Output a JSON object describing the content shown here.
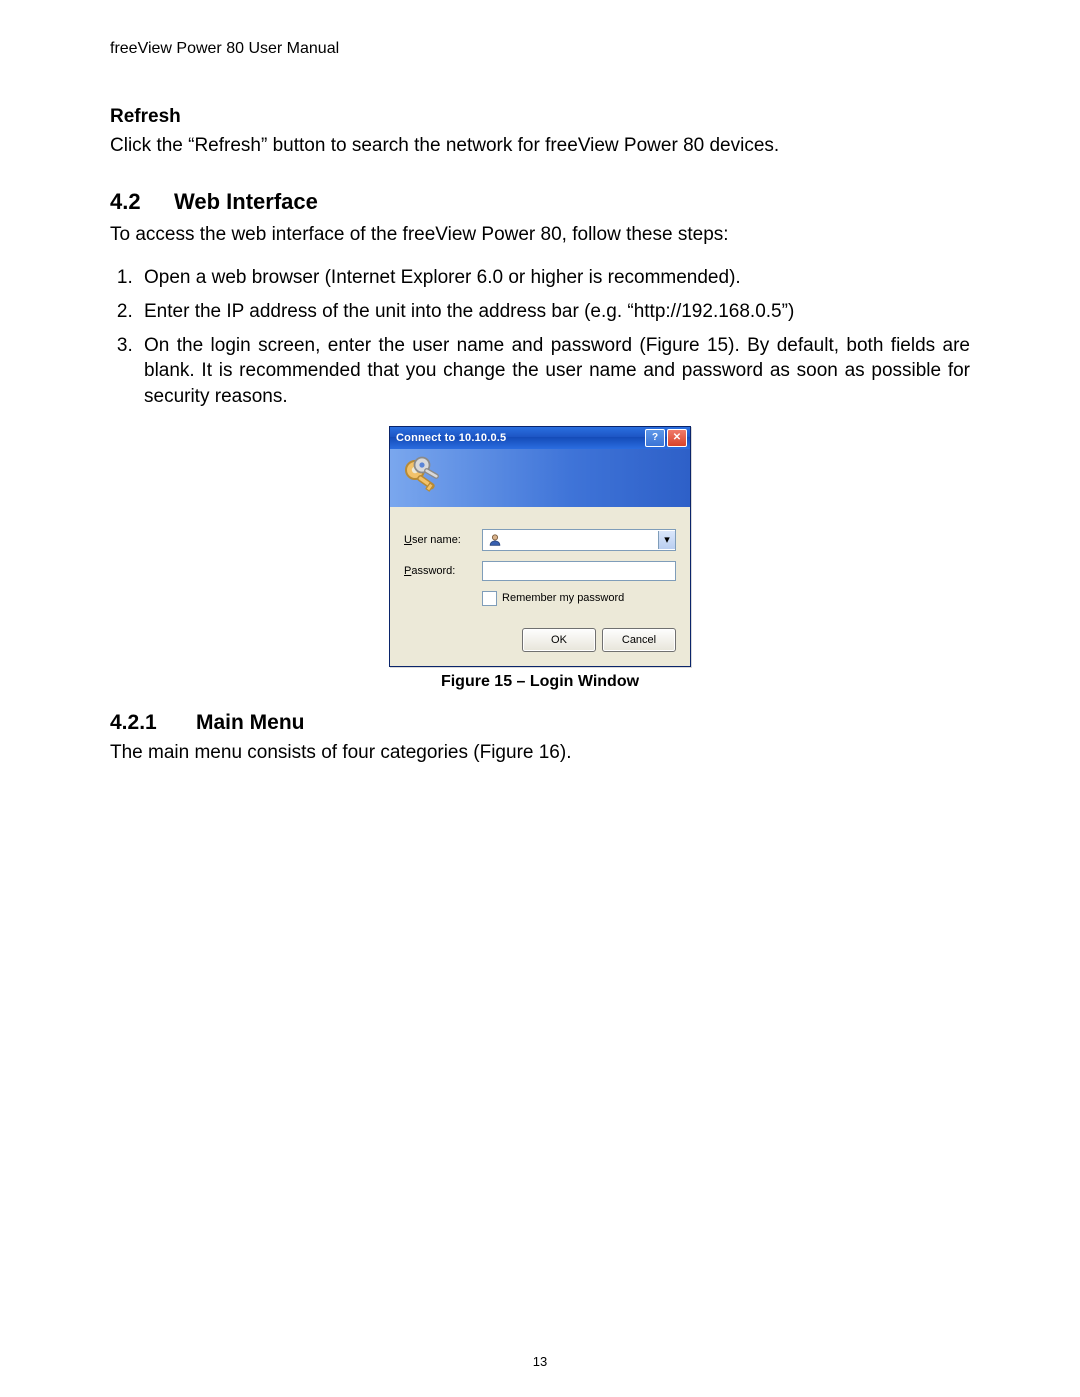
{
  "header": {
    "running": "freeView Power 80 User Manual"
  },
  "refresh": {
    "title": "Refresh",
    "text": "Click the “Refresh” button to search the network for freeView Power 80 devices."
  },
  "section42": {
    "num": "4.2",
    "title": "Web Interface",
    "intro": "To access the web interface of the freeView Power 80, follow these steps:",
    "steps": [
      "Open a web browser (Internet Explorer 6.0 or higher is recommended).",
      "Enter the IP address of the unit into the address bar (e.g. “http://192.168.0.5”)",
      "On the login screen, enter the user name and password (Figure 15).  By default, both fields are blank.  It is recommended that you change the user name and password as soon as possible for security reasons."
    ]
  },
  "dialog": {
    "title": "Connect to 10.10.0.5",
    "help_symbol": "?",
    "close_symbol": "✕",
    "username_label_pre": "U",
    "username_label_rest": "ser name:",
    "password_label_pre": "P",
    "password_label_rest": "assword:",
    "remember_pre": "R",
    "remember_rest": "emember my password",
    "ok_label": "OK",
    "cancel_label": "Cancel",
    "combo_arrow": "▾"
  },
  "figure": {
    "caption": "Figure 15 – Login Window"
  },
  "section421": {
    "num": "4.2.1",
    "title": "Main Menu",
    "text": "The main menu consists of four categories (Figure 16)."
  },
  "page_number": "13"
}
